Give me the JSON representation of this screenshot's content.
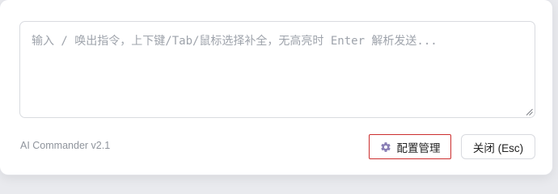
{
  "input": {
    "placeholder": "输入 / 唤出指令，上下键/Tab/鼠标选择补全，无高亮时 Enter 解析发送...",
    "value": ""
  },
  "footer": {
    "version": "AI Commander v2.1",
    "config_label": "配置管理",
    "close_label": "关闭 (Esc)"
  },
  "colors": {
    "highlight_border": "#cc2e2e",
    "gear_icon": "#8a7fb5"
  },
  "icons": {
    "config": "gear-icon",
    "resize": "resize-grip-icon"
  }
}
